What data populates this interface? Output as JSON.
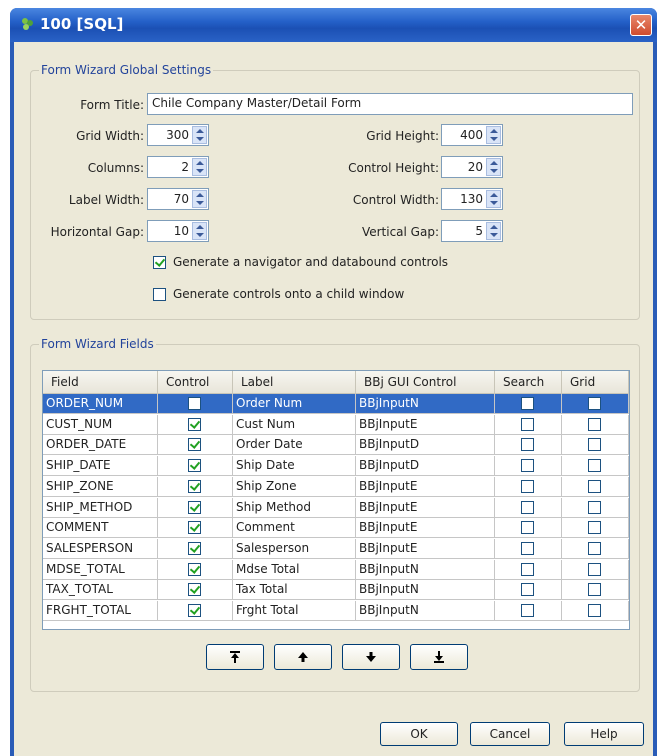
{
  "window": {
    "title": "100 [SQL]",
    "close_symbol": "✕"
  },
  "global_settings": {
    "legend": "Form Wizard Global Settings",
    "form_title_label": "Form Title:",
    "form_title_value": "Chile Company Master/Detail Form",
    "grid_width_label": "Grid Width:",
    "grid_width_value": "300",
    "grid_height_label": "Grid Height:",
    "grid_height_value": "400",
    "columns_label": "Columns:",
    "columns_value": "2",
    "control_height_label": "Control Height:",
    "control_height_value": "20",
    "label_width_label": "Label Width:",
    "label_width_value": "70",
    "control_width_label": "Control Width:",
    "control_width_value": "130",
    "horizontal_gap_label": "Horizontal Gap:",
    "horizontal_gap_value": "10",
    "vertical_gap_label": "Vertical Gap:",
    "vertical_gap_value": "5",
    "gen_navigator_label": "Generate a navigator and databound controls",
    "gen_navigator_checked": true,
    "gen_child_label": "Generate controls onto a child window",
    "gen_child_checked": false
  },
  "fields": {
    "legend": "Form Wizard Fields",
    "headers": [
      "Field",
      "Control",
      "Label",
      "BBj GUI Control",
      "Search",
      "Grid"
    ],
    "rows": [
      {
        "field": "ORDER_NUM",
        "control": false,
        "label": "Order Num",
        "gui": "BBjInputN",
        "search": false,
        "grid": false,
        "selected": true
      },
      {
        "field": "CUST_NUM",
        "control": true,
        "label": "Cust Num",
        "gui": "BBjInputE",
        "search": false,
        "grid": false
      },
      {
        "field": "ORDER_DATE",
        "control": true,
        "label": "Order Date",
        "gui": "BBjInputD",
        "search": false,
        "grid": false
      },
      {
        "field": "SHIP_DATE",
        "control": true,
        "label": "Ship Date",
        "gui": "BBjInputD",
        "search": false,
        "grid": false
      },
      {
        "field": "SHIP_ZONE",
        "control": true,
        "label": "Ship Zone",
        "gui": "BBjInputE",
        "search": false,
        "grid": false
      },
      {
        "field": "SHIP_METHOD",
        "control": true,
        "label": "Ship Method",
        "gui": "BBjInputE",
        "search": false,
        "grid": false
      },
      {
        "field": "COMMENT",
        "control": true,
        "label": "Comment",
        "gui": "BBjInputE",
        "search": false,
        "grid": false
      },
      {
        "field": "SALESPERSON",
        "control": true,
        "label": "Salesperson",
        "gui": "BBjInputE",
        "search": false,
        "grid": false
      },
      {
        "field": "MDSE_TOTAL",
        "control": true,
        "label": "Mdse Total",
        "gui": "BBjInputN",
        "search": false,
        "grid": false
      },
      {
        "field": "TAX_TOTAL",
        "control": true,
        "label": "Tax Total",
        "gui": "BBjInputN",
        "search": false,
        "grid": false
      },
      {
        "field": "FRGHT_TOTAL",
        "control": true,
        "label": "Frght Total",
        "gui": "BBjInputN",
        "search": false,
        "grid": false
      }
    ],
    "move_buttons": [
      {
        "name": "move-top-button",
        "icon": "arrow-to-top-icon"
      },
      {
        "name": "move-up-button",
        "icon": "arrow-up-icon"
      },
      {
        "name": "move-down-button",
        "icon": "arrow-down-icon"
      },
      {
        "name": "move-bottom-button",
        "icon": "arrow-to-bottom-icon"
      }
    ]
  },
  "buttons": {
    "ok": "OK",
    "cancel": "Cancel",
    "help": "Help"
  }
}
